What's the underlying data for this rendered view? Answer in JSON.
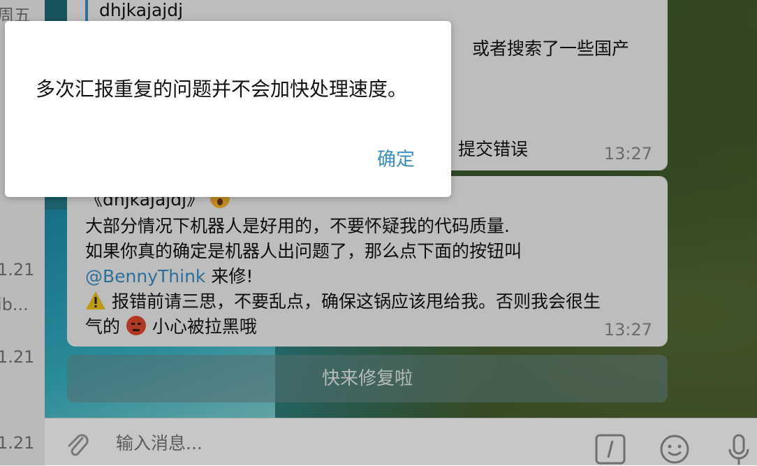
{
  "chat_list": {
    "fragments": [
      "周五",
      "1.21",
      "ib...",
      "1.21",
      "1.21"
    ]
  },
  "messages": [
    {
      "quote": "dhjkajajdj",
      "lines": [
        "或者搜索了一些国产",
        "提交错误"
      ],
      "time": "13:27"
    },
    {
      "lines": [
        "《dhjkajajdj》",
        "大部分情况下机器人是好用的，不要怀疑我的代码质量.",
        "如果你真的确定是机器人出问题了，那么点下面的按钮叫",
        "来修!",
        "报错前请三思，不要乱点，确保这锅应该甩给我。否则我会很生",
        "气的",
        "小心被拉黑哦"
      ],
      "mention": "@BennyThink",
      "time": "13:27"
    }
  ],
  "inline_button": {
    "label": "快来修复啦"
  },
  "composer": {
    "placeholder": "输入消息..."
  },
  "dialog": {
    "message": "多次汇报重复的问题并不会加快处理速度。",
    "ok_label": "确定"
  },
  "colors": {
    "accent": "#3a8fc4",
    "bubble": "#f3f3f3"
  }
}
